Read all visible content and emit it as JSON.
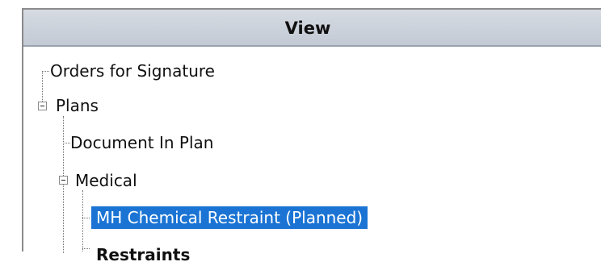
{
  "view_panel": {
    "header_title": "View",
    "tree": {
      "orders_for_signature": "Orders for Signature",
      "plans": "Plans",
      "document_in_plan": "Document In Plan",
      "medical": "Medical",
      "selected_plan": "MH Chemical Restraint (Planned)",
      "partial_next": "Restraints"
    }
  },
  "colors": {
    "header_bg": "#c9d0d9",
    "selection_bg": "#1b74d4",
    "selection_text": "#ffffff"
  },
  "icons": {
    "collapse": "minus-box-icon"
  }
}
